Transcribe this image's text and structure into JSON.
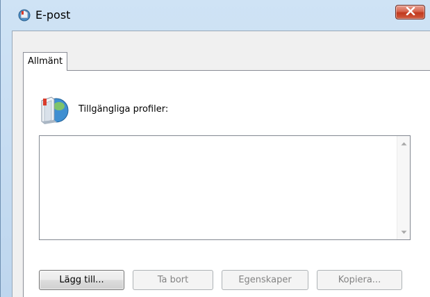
{
  "window": {
    "title": "E-post",
    "close_icon": "close-x-icon"
  },
  "tabs": [
    {
      "label": "Allmänt",
      "selected": true
    }
  ],
  "profiles": {
    "label": "Tillgängliga profiler:",
    "icon": "mail-profile-icon",
    "items": []
  },
  "buttons": {
    "add": "Lägg till...",
    "remove": "Ta bort",
    "properties": "Egenskaper",
    "copy": "Kopiera..."
  },
  "colors": {
    "close_button": "#c1391e",
    "disabled_text": "#838383"
  }
}
